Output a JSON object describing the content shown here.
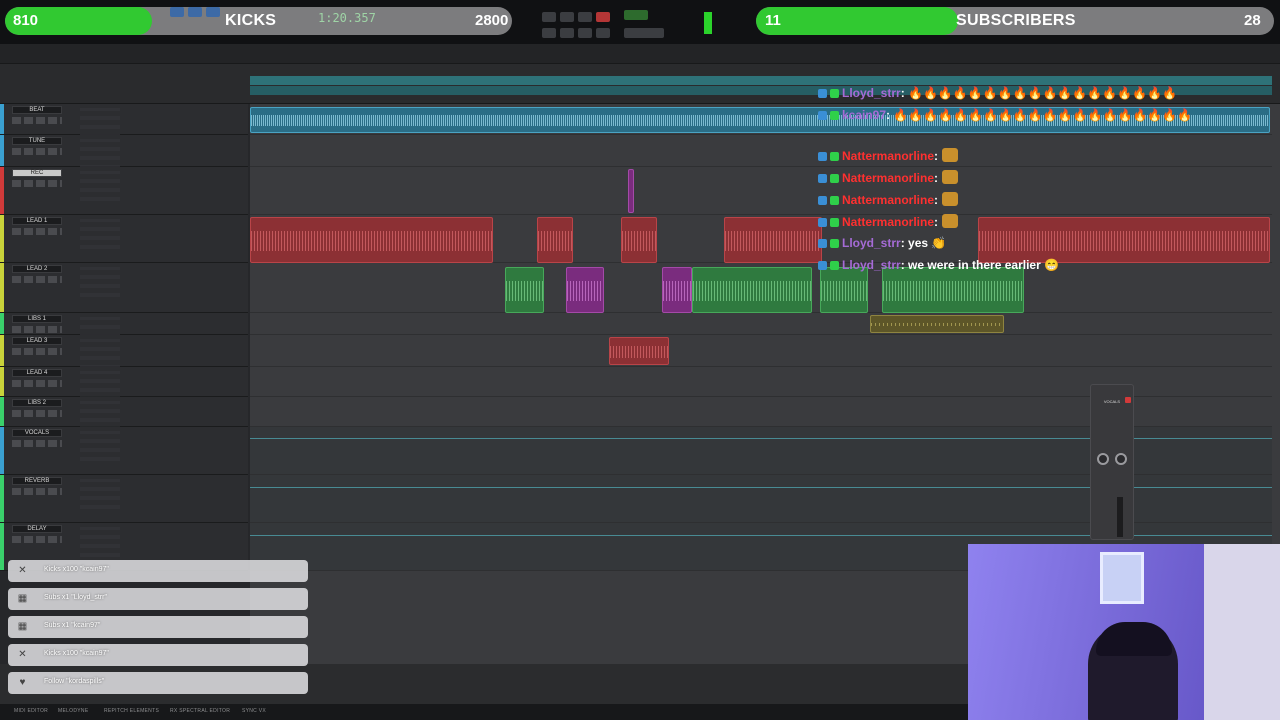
{
  "stream": {
    "kicks_goal": {
      "current": "810",
      "label": "KICKS",
      "target": "2800",
      "progress": 0.29
    },
    "subs_goal": {
      "current": "11",
      "label": "SUBSCRIBERS",
      "target": "28",
      "progress": 0.39
    },
    "accent_green": "#31c931",
    "track_grey": "#7c7c7e"
  },
  "transport": {
    "counter": "1:20.357"
  },
  "tracks": [
    {
      "name": "BEAT",
      "color": "#3aa0d0"
    },
    {
      "name": "TUNE",
      "color": "#3aa0d0"
    },
    {
      "name": "REC",
      "color": "#d03a3a"
    },
    {
      "name": "LEAD 1",
      "color": "#c8d23a"
    },
    {
      "name": "LEAD 2",
      "color": "#c8d23a"
    },
    {
      "name": "LIBS 1",
      "color": "#3ad06b"
    },
    {
      "name": "LEAD 3",
      "color": "#c8d23a"
    },
    {
      "name": "LEAD 4",
      "color": "#c8d23a"
    },
    {
      "name": "LIBS 2",
      "color": "#3ad06b"
    },
    {
      "name": "VOCALS",
      "color": "#3aa0d0"
    },
    {
      "name": "REVERB",
      "color": "#3ad06b"
    },
    {
      "name": "DELAY",
      "color": "#3ad06b"
    }
  ],
  "chat": [
    {
      "user": "Lloyd_strr",
      "text": ": 🔥🔥🔥🔥🔥🔥🔥🔥🔥🔥🔥🔥🔥🔥🔥🔥🔥🔥",
      "user_color": "#a56bd6"
    },
    {
      "user": "kcain97",
      "text": ": 🔥🔥🔥🔥🔥🔥🔥🔥🔥🔥🔥🔥🔥🔥🔥🔥🔥🔥🔥🔥",
      "user_color": "#a56bd6"
    },
    {
      "user": "Nattermanorline",
      "text": ":",
      "user_color": "#ff3030"
    },
    {
      "user": "Nattermanorline",
      "text": ":",
      "user_color": "#ff3030"
    },
    {
      "user": "Nattermanorline",
      "text": ":",
      "user_color": "#ff3030"
    },
    {
      "user": "Nattermanorline",
      "text": ":",
      "user_color": "#ff3030"
    },
    {
      "user": "Lloyd_strr",
      "text": ": yes 👏",
      "user_color": "#a56bd6"
    },
    {
      "user": "Lloyd_strr",
      "text": ": we were in there earlier 😁",
      "user_color": "#a56bd6"
    }
  ],
  "alerts": [
    {
      "icon": "✕",
      "text": "Kicks x100 \"kcain97\""
    },
    {
      "icon": "▦",
      "text": "Subs x1 \"Lloyd_strr\""
    },
    {
      "icon": "▦",
      "text": "Subs x1 \"kcain97\""
    },
    {
      "icon": "✕",
      "text": "Kicks x100 \"kcain97\""
    },
    {
      "icon": "♥",
      "text": "Follow \"kordaspills\""
    }
  ],
  "plugin": {
    "title": "VOCALS"
  },
  "bottom_tabs": [
    "MIDI EDITOR",
    "MELODYNE",
    "REPITCH ELEMENTS",
    "RX SPECTRAL EDITOR",
    "SYNC VX"
  ]
}
